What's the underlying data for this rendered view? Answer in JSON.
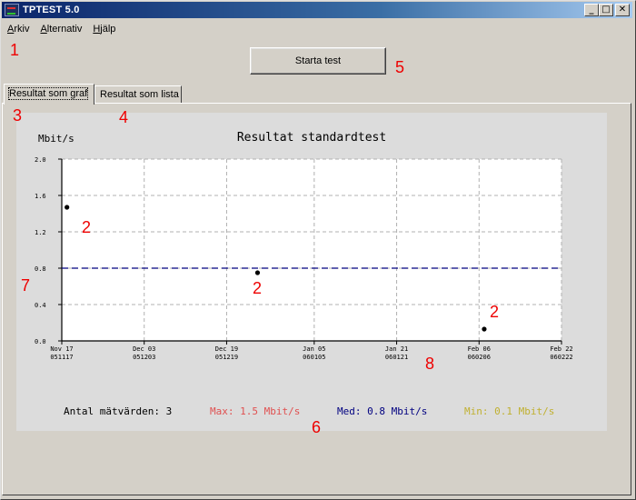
{
  "window": {
    "title": "TPTEST 5.0",
    "controls": {
      "minimize": "_",
      "maximize": "□",
      "close": "✕"
    }
  },
  "menu": {
    "items": [
      {
        "first": "A",
        "rest": "rkiv"
      },
      {
        "first": "A",
        "rest": "lternativ"
      },
      {
        "first": "H",
        "rest": "jälp"
      }
    ]
  },
  "toolbar": {
    "start_label": "Starta test"
  },
  "tabs": [
    {
      "label": "Resultat som graf"
    },
    {
      "label": "Resultat som lista"
    }
  ],
  "chart_data": {
    "type": "scatter",
    "title": "Resultat standardtest",
    "ylabel": "Mbit/s",
    "ylim": [
      0.0,
      2.0
    ],
    "yticks": [
      "2.0",
      "1.6",
      "1.2",
      "0.8",
      "0.4",
      "0.0"
    ],
    "xticks": [
      {
        "date": "Nov 17",
        "code": "051117"
      },
      {
        "date": "Dec 03",
        "code": "051203"
      },
      {
        "date": "Dec 19",
        "code": "051219"
      },
      {
        "date": "Jan 05",
        "code": "060105"
      },
      {
        "date": "Jan 21",
        "code": "060121"
      },
      {
        "date": "Feb 06",
        "code": "060206"
      },
      {
        "date": "Feb 22",
        "code": "060222"
      }
    ],
    "points": [
      {
        "x": "2005-11-18",
        "y": 1.47
      },
      {
        "x": "2005-12-25",
        "y": 0.75
      },
      {
        "x": "2006-02-07",
        "y": 0.13
      }
    ],
    "mean_line": 0.8,
    "grid": true,
    "footer": {
      "count": "Antal mätvärden: 3",
      "max": "Max: 1.5 Mbit/s",
      "med": "Med: 0.8 Mbit/s",
      "min": "Min: 0.1 Mbit/s"
    },
    "colors": {
      "point": "#000000",
      "mean": "#000080",
      "max": "#e05050",
      "med": "#000080",
      "min": "#c0b030",
      "grid": "#b0b0b0"
    }
  },
  "annotations": [
    "1",
    "2",
    "2",
    "2",
    "3",
    "4",
    "5",
    "6",
    "7",
    "8"
  ]
}
